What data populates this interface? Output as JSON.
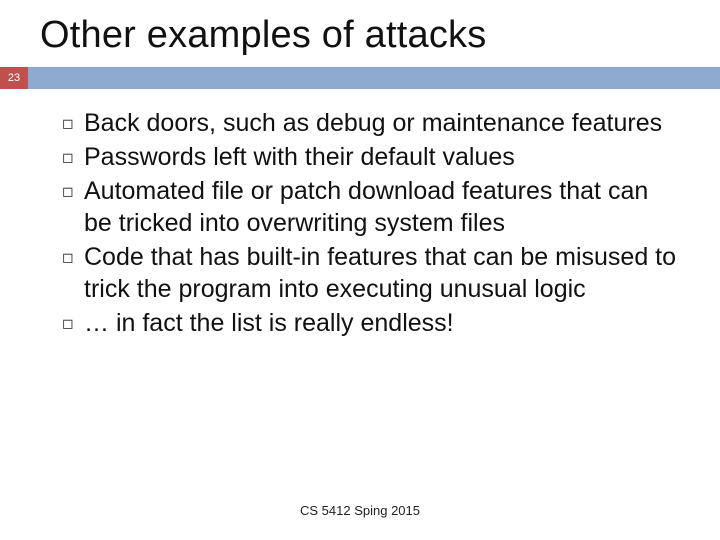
{
  "title": "Other examples of attacks",
  "page_number": "23",
  "bullets": [
    "Back doors, such as debug or maintenance features",
    "Passwords left with their default values",
    "Automated file or patch download features that can be tricked into overwriting system files",
    "Code that has built-in features that can be misused to trick the program into executing unusual logic",
    "… in fact the list is really endless!"
  ],
  "footer": "CS 5412 Sping 2015"
}
